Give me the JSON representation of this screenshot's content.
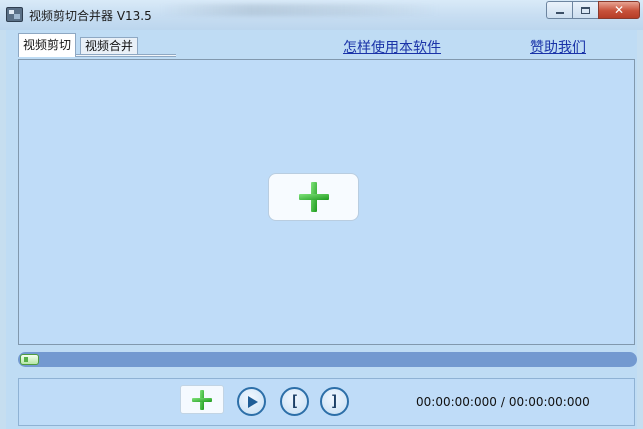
{
  "window": {
    "title": "视频剪切合并器 V13.5",
    "controls": {
      "minimize": "minimize",
      "maximize": "maximize",
      "close": "close"
    }
  },
  "tabs": [
    {
      "label": "视频剪切",
      "active": true
    },
    {
      "label": "视频合并",
      "active": false
    }
  ],
  "links": {
    "how_to_use": "怎样使用本软件",
    "donate": "赞助我们"
  },
  "preview": {
    "add_button_icon": "green-plus-icon"
  },
  "progress": {
    "position": 0
  },
  "controls": {
    "add_icon": "green-plus-icon",
    "play_icon": "play-icon",
    "mark_in_icon": "left-bracket-icon",
    "mark_out_icon": "right-bracket-icon",
    "current_time": "00:00:00:000",
    "separator": "/",
    "total_time": "00:00:00:000"
  },
  "colors": {
    "accent_green": "#2fb52a",
    "link_blue": "#1a33a8",
    "progress_track": "#7399d0",
    "window_bg": "#c6def0"
  }
}
